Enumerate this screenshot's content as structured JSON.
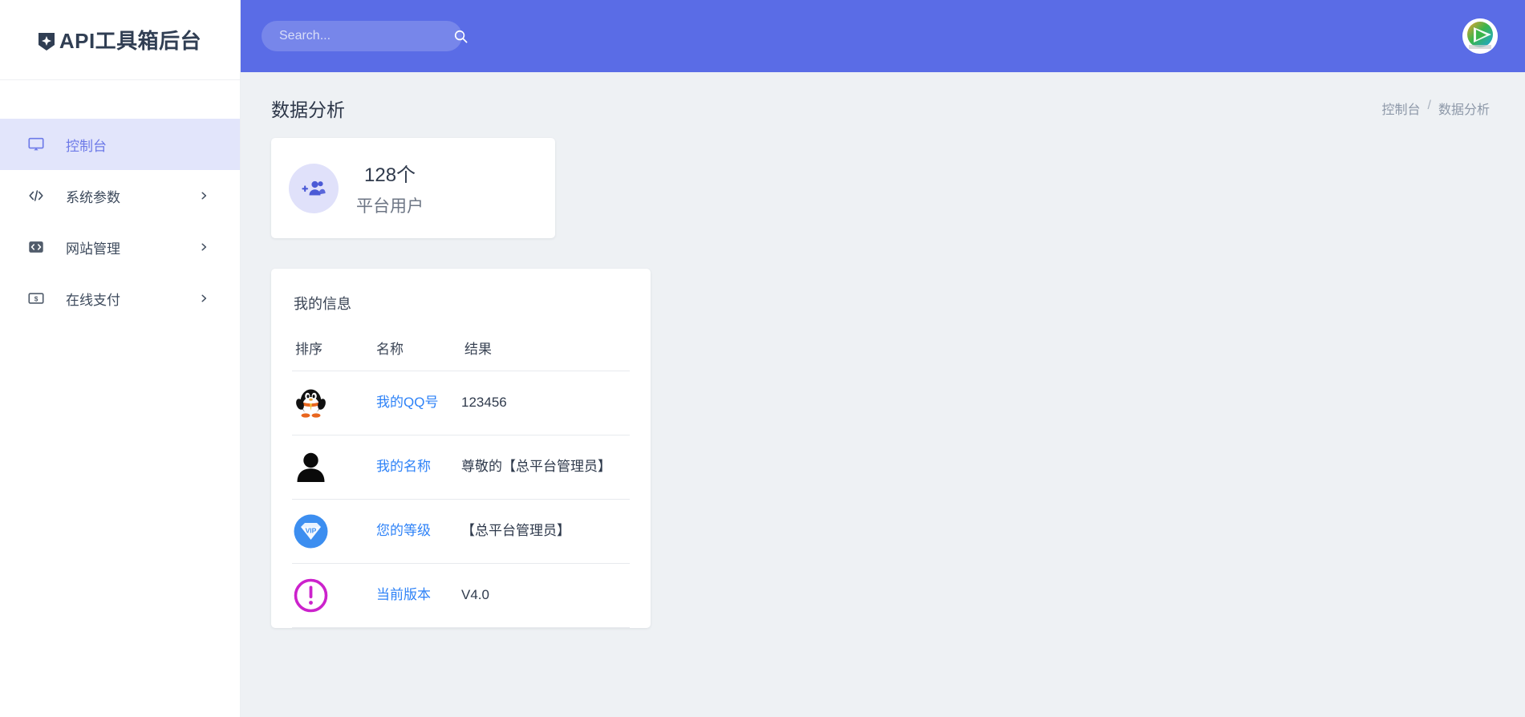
{
  "brand": {
    "logo_icon": "shield-badge-icon",
    "title": "API工具箱后台"
  },
  "sidebar": {
    "items": [
      {
        "label": "控制台",
        "icon": "monitor-icon",
        "active": true,
        "has_chevron": false
      },
      {
        "label": "系统参数",
        "icon": "code-slash-icon",
        "active": false,
        "has_chevron": true
      },
      {
        "label": "网站管理",
        "icon": "code-box-icon",
        "active": false,
        "has_chevron": true
      },
      {
        "label": "在线支付",
        "icon": "banknote-icon",
        "active": false,
        "has_chevron": true
      }
    ]
  },
  "topbar": {
    "search": {
      "value": "",
      "placeholder": "Search...",
      "icon": "search-icon"
    },
    "avatar_icon": "tencent-video-play-avatar"
  },
  "page": {
    "title": "数据分析",
    "breadcrumb": {
      "parent": "控制台",
      "separator": "/",
      "current": "数据分析"
    }
  },
  "stat_card": {
    "icon": "add-users-icon",
    "value": "128个",
    "label": "平台用户"
  },
  "info_card": {
    "title": "我的信息",
    "columns": [
      "排序",
      "名称",
      "结果"
    ],
    "rows": [
      {
        "icon": "qq-penguin-icon",
        "name": "我的QQ号",
        "result": "123456"
      },
      {
        "icon": "user-silhouette-icon",
        "name": "我的名称",
        "result": "尊敬的【总平台管理员】"
      },
      {
        "icon": "vip-badge-icon",
        "name": "您的等级",
        "result": "【总平台管理员】"
      },
      {
        "icon": "exclamation-circle-icon",
        "name": "当前版本",
        "result": "V4.0"
      }
    ]
  },
  "colors": {
    "header": "#5a6ce6",
    "sidebar_active_bg": "#e2e5fb",
    "sidebar_active_text": "#6d7ae8",
    "page_bg": "#eef1f4",
    "link": "#2e82f7"
  }
}
